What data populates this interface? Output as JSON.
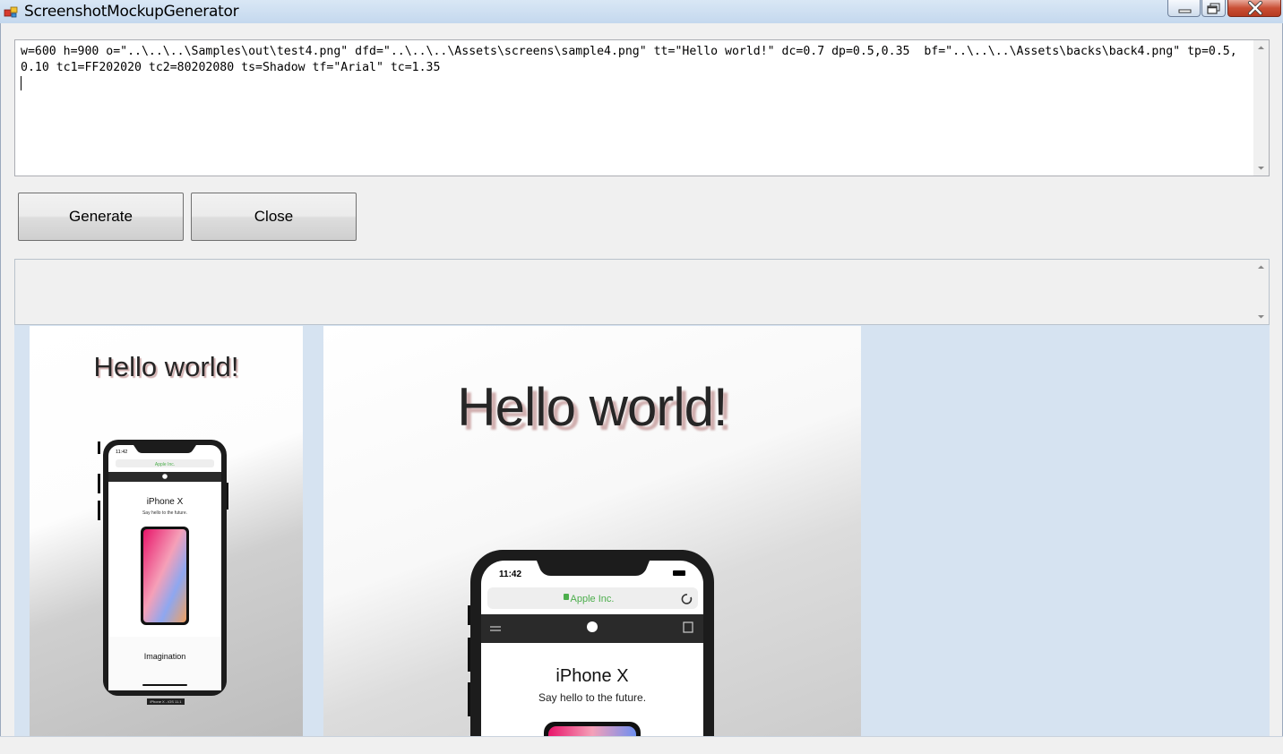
{
  "window": {
    "title": "ScreenshotMockupGenerator",
    "icon": "app-icon",
    "controls": [
      "minimize-icon",
      "maximize-icon",
      "close-icon"
    ]
  },
  "command_input": {
    "value": "w=600 h=900 o=\"..\\..\\..\\Samples\\out\\test4.png\" dfd=\"..\\..\\..\\Assets\\screens\\sample4.png\" tt=\"Hello world!\" dc=0.7 dp=0.5,0.35  bf=\"..\\..\\..\\Assets\\backs\\back4.png\" tp=0.5,0.10 tc1=FF202020 tc2=80202080 ts=Shadow tf=\"Arial\" tc=1.35"
  },
  "buttons": {
    "generate": "Generate",
    "close": "Close"
  },
  "log": {
    "value": ""
  },
  "preview": {
    "background": "#d6e3f1",
    "thumb_small": {
      "headline": "Hello world!",
      "time": "11:42",
      "url": "Apple Inc.",
      "product": "iPhone X",
      "tagline": "Say hello to the future.",
      "feature": "Imagination",
      "caption": "iPhone X - iOS 11.1"
    },
    "thumb_large": {
      "headline": "Hello world!",
      "time": "11:42",
      "url": "Apple Inc.",
      "product": "iPhone X",
      "tagline": "Say hello to the future."
    }
  },
  "colors": {
    "text_color": "#202020",
    "shadow_color": "#802020",
    "url_green": "#4cae4c",
    "close_button_red": "#c94f35"
  }
}
